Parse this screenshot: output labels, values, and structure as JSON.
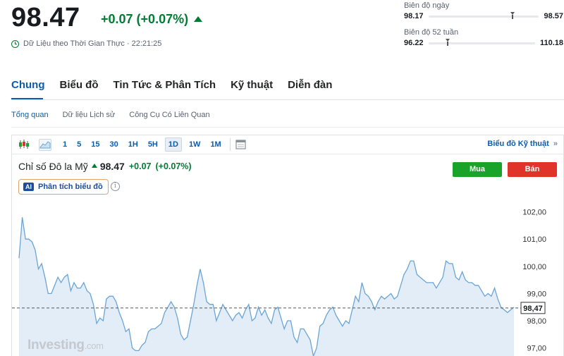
{
  "quote": {
    "price": "98.47",
    "change": "+0.07 (+0.07%)",
    "realtime_label": "Dữ Liệu theo Thời Gian Thực · 22:21:25"
  },
  "day_range": {
    "label": "Biên độ ngày",
    "low": "98.17",
    "high": "98.57",
    "position": 0.74
  },
  "week52_range": {
    "label": "Biên độ 52 tuần",
    "low": "96.22",
    "high": "110.18",
    "position": 0.16
  },
  "tabs": [
    {
      "label": "Chung",
      "active": true
    },
    {
      "label": "Biểu đồ",
      "active": false
    },
    {
      "label": "Tin Tức & Phân Tích",
      "active": false
    },
    {
      "label": "Kỹ thuật",
      "active": false
    },
    {
      "label": "Diễn đàn",
      "active": false
    }
  ],
  "subtabs": [
    {
      "label": "Tổng quan",
      "active": true
    },
    {
      "label": "Dữ liệu Lịch sử",
      "active": false
    },
    {
      "label": "Công Cụ Có Liên Quan",
      "active": false
    }
  ],
  "toolbar": {
    "icons": [
      "candlestick-icon",
      "area-chart-icon",
      "calendar-icon"
    ],
    "timeframes": [
      "1",
      "5",
      "15",
      "30",
      "1H",
      "5H",
      "1D",
      "1W",
      "1M"
    ],
    "selected_timeframe": "1D",
    "advanced_label": "Biểu đồ Kỹ thuật",
    "advanced_arrow": "»"
  },
  "instrument": {
    "name": "Chỉ số Đô la Mỹ",
    "price": "98.47",
    "change": "+0.07",
    "change_pct": "(+0.07%)"
  },
  "ai_button": {
    "badge": "AI",
    "label": "Phân tích biểu đồ"
  },
  "info_glyph": "i",
  "buy_label": "Mua",
  "sell_label": "Bán",
  "watermark": {
    "brand": "Investing",
    "domain": ".com"
  },
  "colors": {
    "accent": "#0a5cae",
    "positive": "#007c32",
    "buy": "#1aa329",
    "sell": "#e0342a",
    "line": "#6aa5d6",
    "area": "#dbe9f5"
  },
  "chart_data": {
    "type": "area",
    "title": "",
    "xlabel": "",
    "ylabel": "",
    "ylim": [
      96.6,
      102.3
    ],
    "y_ticks": [
      "102,00",
      "101,00",
      "100,00",
      "99,00",
      "98,00",
      "97,00"
    ],
    "y_tick_values": [
      102,
      101,
      100,
      99,
      98,
      97
    ],
    "current_value": 98.47,
    "current_label": "98,47",
    "grid": false,
    "values": [
      100.3,
      101.8,
      101.0,
      101.0,
      100.9,
      100.6,
      99.9,
      100.1,
      99.6,
      99.0,
      99.0,
      99.3,
      99.6,
      99.4,
      99.6,
      99.7,
      99.1,
      99.4,
      99.2,
      99.2,
      99.4,
      99.1,
      99.0,
      98.6,
      97.9,
      98.1,
      98.0,
      98.8,
      98.9,
      98.9,
      98.7,
      98.3,
      98.0,
      97.6,
      97.7,
      97.0,
      96.9,
      96.9,
      97.1,
      97.2,
      97.6,
      97.7,
      97.7,
      97.8,
      97.9,
      98.3,
      98.5,
      98.7,
      98.5,
      98.1,
      97.5,
      97.3,
      97.4,
      98.0,
      98.6,
      99.3,
      99.9,
      99.4,
      98.7,
      98.6,
      98.6,
      98.0,
      98.3,
      98.6,
      98.4,
      98.2,
      98.0,
      98.2,
      98.3,
      98.1,
      98.4,
      98.6,
      98.0,
      98.1,
      98.5,
      98.2,
      98.4,
      98.1,
      97.9,
      98.4,
      98.5,
      98.1,
      97.7,
      98.0,
      98.0,
      97.4,
      97.2,
      97.7,
      97.7,
      97.5,
      97.3,
      96.7,
      97.0,
      97.8,
      97.9,
      98.2,
      98.4,
      98.5,
      98.2,
      98.0,
      97.8,
      98.0,
      97.9,
      98.4,
      98.9,
      98.7,
      99.4,
      99.0,
      98.9,
      98.7,
      98.4,
      98.7,
      98.9,
      98.8,
      98.9,
      99.0,
      98.8,
      98.9,
      99.3,
      99.7,
      99.9,
      100.2,
      100.2,
      99.7,
      99.6,
      99.5,
      99.4,
      99.4,
      99.4,
      99.2,
      99.4,
      99.6,
      100.2,
      100.1,
      100.1,
      99.6,
      99.5,
      99.8,
      99.5,
      99.4,
      99.4,
      99.3,
      99.3,
      99.1,
      98.9,
      99.0,
      98.9,
      99.2,
      98.8,
      98.5,
      98.4,
      98.3,
      98.4,
      98.5
    ]
  }
}
